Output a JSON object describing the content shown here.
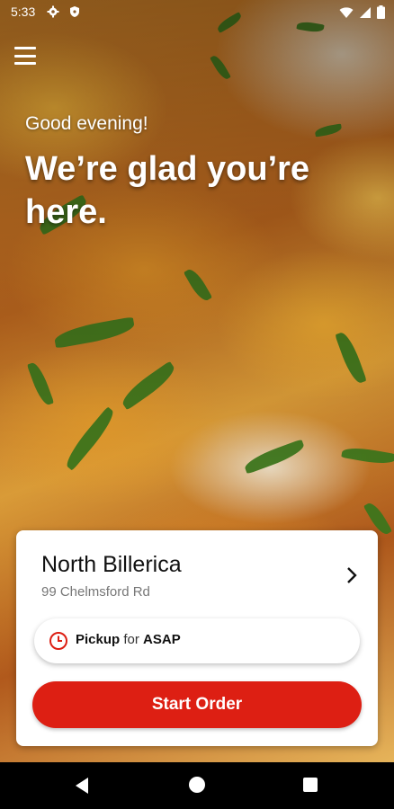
{
  "status_bar": {
    "time": "5:33",
    "icons": [
      "gear-icon",
      "shield-icon",
      "wifi-icon",
      "signal-icon",
      "battery-icon"
    ]
  },
  "header": {
    "menu_icon": "hamburger-menu-icon",
    "greeting": "Good evening!",
    "headline": "We’re glad you’re here."
  },
  "location": {
    "name": "North Billerica",
    "address": "99 Chelmsford Rd"
  },
  "pickup": {
    "mode": "Pickup",
    "connector": "for",
    "time": "ASAP"
  },
  "actions": {
    "start_order_label": "Start Order"
  },
  "colors": {
    "accent": "#dd1f13",
    "card_background": "#ffffff",
    "nav_bar": "#000000"
  },
  "nav": {
    "icons": [
      "back-icon",
      "home-icon",
      "recents-icon"
    ]
  }
}
